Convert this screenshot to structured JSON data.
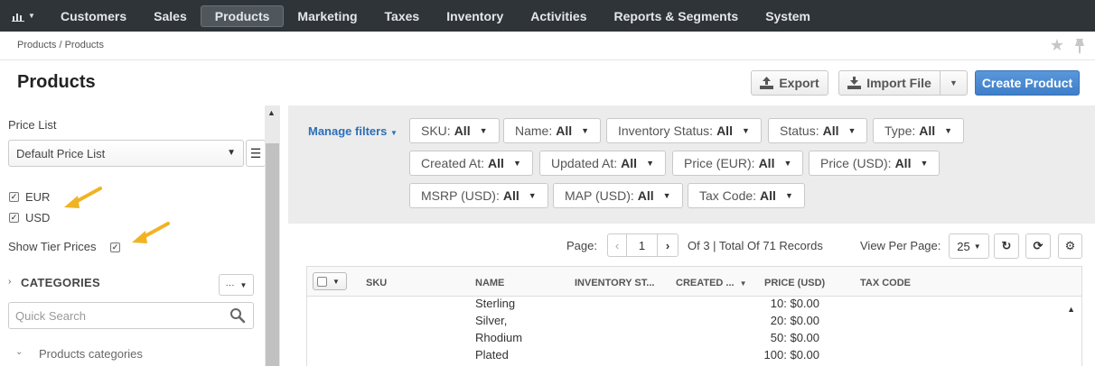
{
  "topnav": {
    "items": [
      "Customers",
      "Sales",
      "Products",
      "Marketing",
      "Taxes",
      "Inventory",
      "Activities",
      "Reports & Segments",
      "System"
    ],
    "active": "Products"
  },
  "breadcrumb": "Products / Products",
  "page": {
    "title": "Products",
    "export_label": "Export",
    "import_label": "Import File",
    "create_label": "Create Product"
  },
  "sidebar": {
    "price_list_label": "Price List",
    "price_list_value": "Default Price List",
    "currencies": [
      {
        "label": "EUR",
        "checked": true
      },
      {
        "label": "USD",
        "checked": true
      }
    ],
    "tier_label": "Show Tier Prices",
    "tier_checked": true,
    "categories_label": "CATEGORIES",
    "categories_btn": "···",
    "quick_search_placeholder": "Quick Search",
    "tree_root": "Products categories"
  },
  "filters": {
    "manage_label": "Manage filters",
    "items": [
      {
        "name": "SKU:",
        "value": "All"
      },
      {
        "name": "Name:",
        "value": "All"
      },
      {
        "name": "Inventory Status:",
        "value": "All"
      },
      {
        "name": "Status:",
        "value": "All"
      },
      {
        "name": "Type:",
        "value": "All"
      },
      {
        "name": "Created At:",
        "value": "All"
      },
      {
        "name": "Updated At:",
        "value": "All"
      },
      {
        "name": "Price (EUR):",
        "value": "All"
      },
      {
        "name": "Price (USD):",
        "value": "All"
      },
      {
        "name": "MSRP (USD):",
        "value": "All"
      },
      {
        "name": "MAP (USD):",
        "value": "All"
      },
      {
        "name": "Tax Code:",
        "value": "All"
      }
    ]
  },
  "pager": {
    "page_label": "Page:",
    "page_value": "1",
    "of_text": "Of 3 | Total Of 71 Records",
    "per_page_label": "View Per Page:",
    "per_page_value": "25"
  },
  "grid": {
    "columns": [
      "SKU",
      "NAME",
      "INVENTORY ST...",
      "CREATED ...",
      "PRICE (USD)",
      "TAX CODE"
    ],
    "rows": [
      {
        "name": "Sterling",
        "price": "10: $0.00"
      },
      {
        "name": "Silver,",
        "price": "20: $0.00"
      },
      {
        "name": "Rhodium",
        "price": "50: $0.00"
      },
      {
        "name": "Plated",
        "price": "100: $0.00"
      }
    ]
  },
  "colors": {
    "nav_bg": "#2f3438",
    "primary": "#4a89d4",
    "link": "#2c6fb6",
    "arrow": "#f0b323"
  }
}
